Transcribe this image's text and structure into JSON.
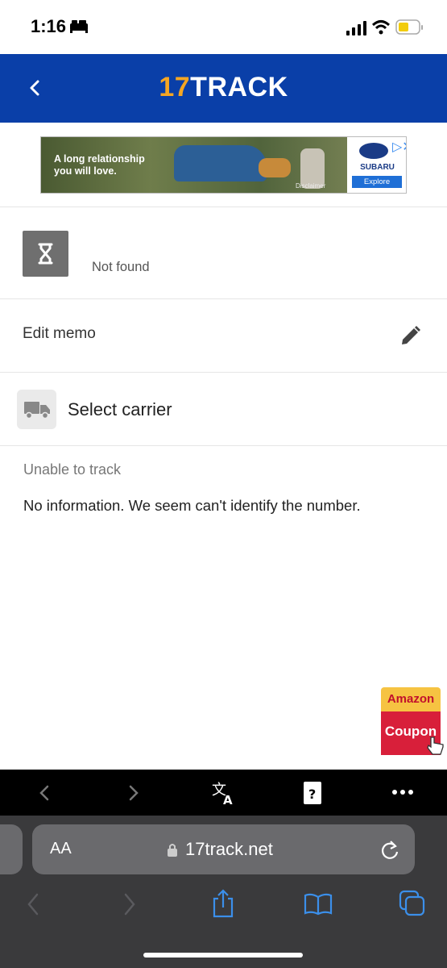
{
  "status_bar": {
    "time": "1:16"
  },
  "header": {
    "logo_number": "17",
    "logo_word": "TRACK"
  },
  "ad": {
    "headline_line1": "A long relationship",
    "headline_line2": "you will love.",
    "disclaimer": "Disclaimer",
    "brand": "SUBARU",
    "cta": "Explore"
  },
  "shipment": {
    "status": "Not found"
  },
  "memo": {
    "label": "Edit memo"
  },
  "carrier": {
    "label": "Select carrier"
  },
  "tracking": {
    "heading": "Unable to track",
    "message": "No information. We seem can't identify the number."
  },
  "coupon": {
    "top": "Amazon",
    "bottom": "Coupon"
  },
  "browser": {
    "aa_label": "AA",
    "url": "17track.net"
  },
  "colors": {
    "header_bg": "#0a3fa8",
    "logo_accent": "#f5a623",
    "coupon_red": "#d81f3a",
    "coupon_yellow": "#f6c342"
  }
}
